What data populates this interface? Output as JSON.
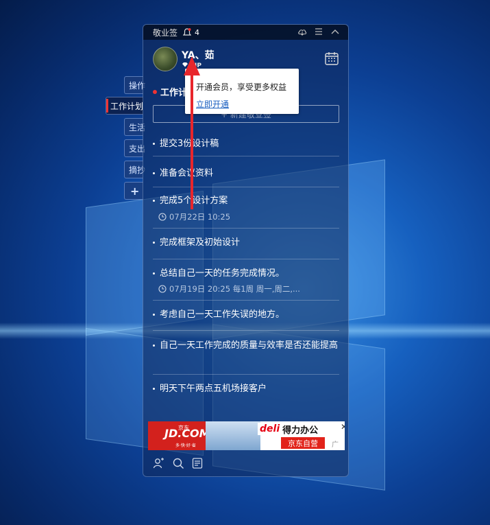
{
  "widget": {
    "app_title": "敬业签",
    "notification_count": "4",
    "user": {
      "name": "YA、茹",
      "vip_label": "VIP"
    },
    "tooltip": {
      "text": "开通会员，享受更多权益",
      "link": "立即开通"
    },
    "section_title": "工作计划",
    "new_button_label": "+ 新建敬业签",
    "items": [
      {
        "text": "提交3份设计稿",
        "meta": ""
      },
      {
        "text": "准备会议资料",
        "meta": ""
      },
      {
        "text": "完成5个设计方案",
        "meta": "07月22日 10:25"
      },
      {
        "text": "完成框架及初始设计",
        "meta": ""
      },
      {
        "text": "总结自己一天的任务完成情况。",
        "meta": "07月19日 20:25 每1周 周一,周二,..."
      },
      {
        "text": "考虑自己一天工作失误的地方。",
        "meta": ""
      },
      {
        "text": "自己一天工作完成的质量与效率是否还能提高",
        "meta": ""
      },
      {
        "text": "明天下午两点五机场接客户",
        "meta": ""
      }
    ],
    "ad": {
      "jd_logo": "JD.COM",
      "jd_sub": "京东",
      "jd_tag": "多·快·好·省",
      "deli_brand": "deli",
      "deli_slogan": "得力办公",
      "jd_self": "京东自营",
      "ad_label": "广告",
      "close": "✕"
    }
  },
  "side_tabs": [
    {
      "label": "操作",
      "active": false
    },
    {
      "label": "工作计划",
      "active": true
    },
    {
      "label": "生活",
      "active": false
    },
    {
      "label": "支出",
      "active": false
    },
    {
      "label": "摘抄",
      "active": false
    },
    {
      "label": "+",
      "active": false
    }
  ],
  "colors": {
    "accent_red": "#e33333",
    "link_blue": "#1a5fc0",
    "jd_red": "#d3211d"
  }
}
